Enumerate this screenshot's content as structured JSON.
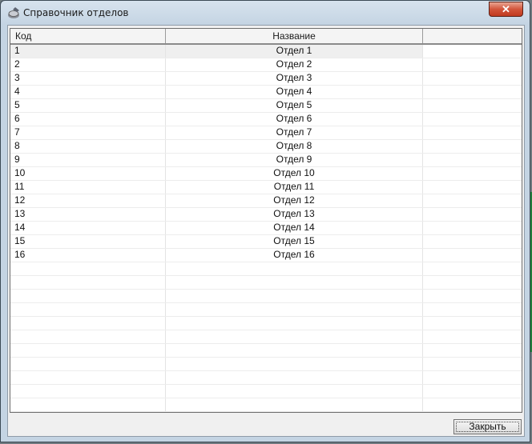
{
  "window": {
    "title": "Справочник отделов",
    "close_glyph": "✕",
    "icon": "app-icon"
  },
  "grid": {
    "columns": [
      "Код",
      "Название",
      ""
    ],
    "rows": [
      [
        "1",
        "Отдел 1"
      ],
      [
        "2",
        "Отдел 2"
      ],
      [
        "3",
        "Отдел 3"
      ],
      [
        "4",
        "Отдел 4"
      ],
      [
        "5",
        "Отдел 5"
      ],
      [
        "6",
        "Отдел 6"
      ],
      [
        "7",
        "Отдел 7"
      ],
      [
        "8",
        "Отдел 8"
      ],
      [
        "9",
        "Отдел 9"
      ],
      [
        "10",
        "Отдел 10"
      ],
      [
        "11",
        "Отдел 11"
      ],
      [
        "12",
        "Отдел 12"
      ],
      [
        "13",
        "Отдел 13"
      ],
      [
        "14",
        "Отдел 14"
      ],
      [
        "15",
        "Отдел 15"
      ],
      [
        "16",
        "Отдел 16"
      ]
    ],
    "selected_row_index": 0
  },
  "footer": {
    "close_button_label": "Закрыть"
  }
}
